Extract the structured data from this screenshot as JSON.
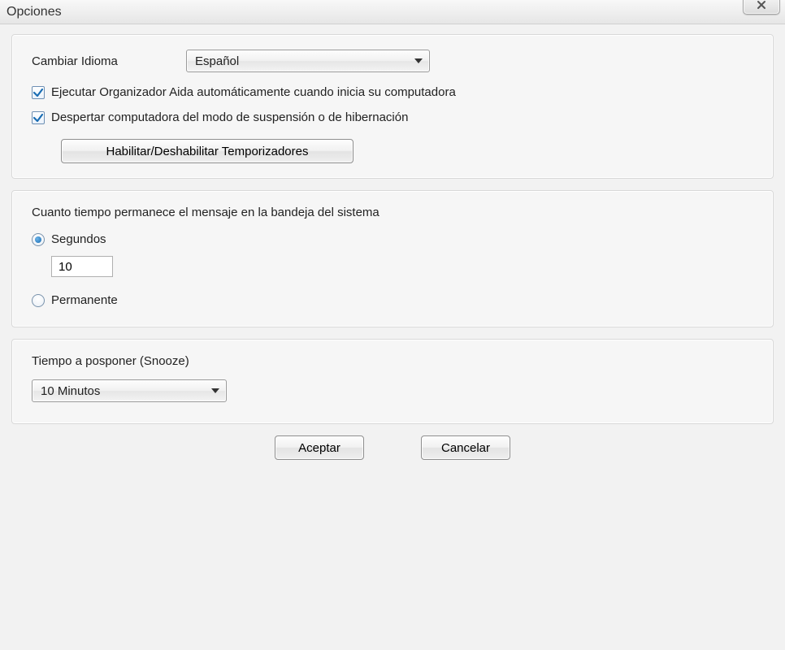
{
  "window": {
    "title": "Opciones"
  },
  "group1": {
    "language_label": "Cambiar Idioma",
    "language_value": "Español",
    "autostart_label": "Ejecutar Organizador Aida automáticamente cuando inicia su computadora",
    "autostart_checked": true,
    "wake_label": "Despertar computadora del modo de suspensión o de hibernación",
    "wake_checked": true,
    "timers_button": "Habilitar/Deshabilitar Temporizadores"
  },
  "group2": {
    "message_duration_label": "Cuanto tiempo permanece el mensaje en la bandeja del sistema",
    "seconds_label": "Segundos",
    "seconds_value": "10",
    "permanent_label": "Permanente",
    "selected": "seconds"
  },
  "group3": {
    "snooze_label": "Tiempo a posponer (Snooze)",
    "snooze_value": "10 Minutos"
  },
  "footer": {
    "accept": "Aceptar",
    "cancel": "Cancelar"
  }
}
